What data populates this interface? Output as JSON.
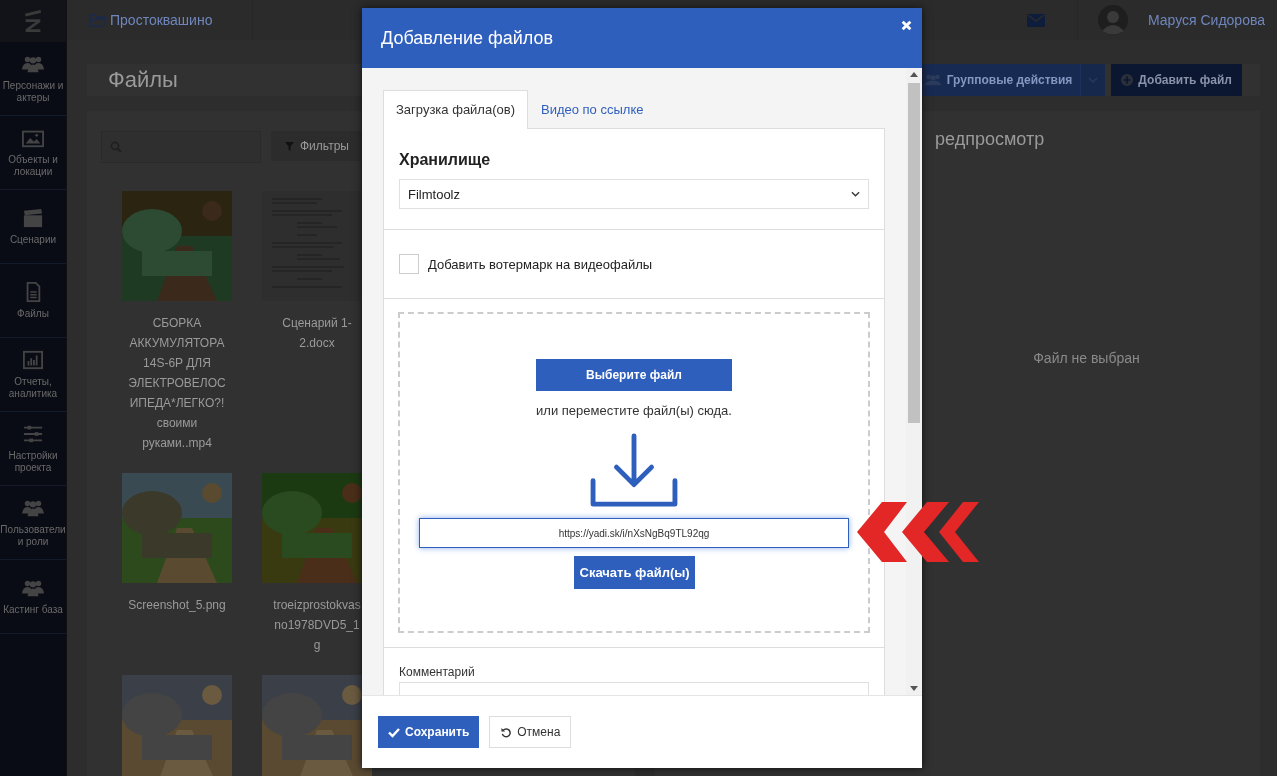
{
  "sidebar": {
    "items": [
      {
        "label": "Персонажи и актеры"
      },
      {
        "label": "Объекты и локации"
      },
      {
        "label": "Сценарии"
      },
      {
        "label": "Файлы"
      },
      {
        "label": "Отчеты, аналитика"
      },
      {
        "label": "Настройки проекта"
      },
      {
        "label": "Пользователи и роли"
      },
      {
        "label": "Кастинг база"
      }
    ]
  },
  "topbar": {
    "project": "Простоквашино",
    "user": "Маруся Сидорова"
  },
  "page": {
    "title": "Файлы",
    "group_actions": "Групповые действия",
    "add_file": "Добавить файл",
    "filters": "Фильтры",
    "files": [
      {
        "label_lines": [
          "СБОРКА",
          "АККУМУЛЯТОРА",
          "14S-6P ДЛЯ",
          "ЭЛЕКТРОВЕЛОС",
          "ИПЕДА*ЛЕГКО?!",
          "своими",
          "руками..mp4"
        ],
        "kind": "picture"
      },
      {
        "label_lines": [
          "Сценарий 1-",
          "2.docx"
        ],
        "kind": "document"
      },
      {
        "label_lines": [
          "Screenshot_5.png"
        ],
        "kind": "picture"
      },
      {
        "label_lines": [
          "troeizprostokvas",
          "no1978DVD5_1",
          "g"
        ],
        "kind": "picture"
      },
      {
        "kind": "picture"
      },
      {
        "kind": "picture"
      }
    ],
    "preview_title": "редпросмотр",
    "preview_empty": "Файл не выбран"
  },
  "modal": {
    "title": "Добавление файлов",
    "tabs": [
      {
        "label": "Загрузка файла(ов)",
        "selected": true
      },
      {
        "label": "Видео по ссылке",
        "selected": false
      }
    ],
    "storage_label": "Хранилище",
    "storage_value": "Filmtoolz",
    "watermark": {
      "label": "Добавить вотермарк на видеофайлы",
      "checked": false
    },
    "choose_button": "Выберите файл",
    "drop_hint": "или переместите файл(ы) сюда.",
    "url_value": "https://yadi.sk/i/nXsNgBq9TL92qg",
    "download_button": "Скачать файл(ы)",
    "comment_label": "Комментарий",
    "save": "Сохранить",
    "cancel": "Отмена"
  }
}
